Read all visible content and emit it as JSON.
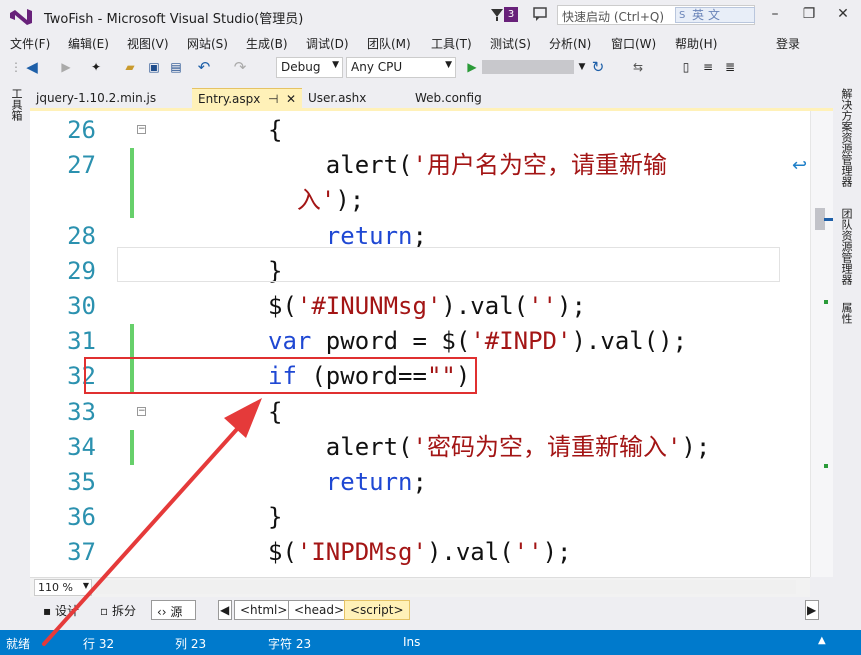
{
  "window": {
    "title": "TwoFish - Microsoft Visual Studio(管理员)",
    "notification_count": "3",
    "quick_launch_placeholder": "快速启动 (Ctrl+Q)",
    "ime_indicator": "英文",
    "ime_mark": "S",
    "controls": {
      "minimize": "–",
      "restore": "❐",
      "close": "✕"
    }
  },
  "menu": {
    "items": [
      "文件(F)",
      "编辑(E)",
      "视图(V)",
      "网站(S)",
      "生成(B)",
      "调试(D)",
      "团队(M)",
      "工具(T)",
      "测试(S)",
      "分析(N)",
      "窗口(W)",
      "帮助(H)"
    ],
    "login": "登录"
  },
  "toolbar": {
    "configuration": "Debug",
    "platform": "Any CPU",
    "start_icon": "▶"
  },
  "side_tabs": {
    "left": "工具箱",
    "right": [
      "解决方案资源管理器",
      "团队资源管理器",
      "属性"
    ]
  },
  "tabs": [
    {
      "label": "jquery-1.10.2.min.js",
      "active": false
    },
    {
      "label": "Entry.aspx",
      "active": true,
      "pin": "⊣",
      "close": "✕"
    },
    {
      "label": "User.ashx",
      "active": false
    },
    {
      "label": "Web.config",
      "active": false
    }
  ],
  "code_lines": [
    {
      "n": "26",
      "fold": "−",
      "bar": false,
      "parts": [
        {
          "t": "{",
          "c": "plain"
        }
      ]
    },
    {
      "n": "27",
      "fold": "",
      "bar": true,
      "parts": [
        {
          "t": "    alert(",
          "c": "plain"
        },
        {
          "t": "'用户名为空，请重新输",
          "c": "str"
        }
      ]
    },
    {
      "n": "",
      "fold": "",
      "bar": true,
      "parts": [
        {
          "t": "  入'",
          "c": "str"
        },
        {
          "t": ");",
          "c": "plain"
        }
      ]
    },
    {
      "n": "28",
      "fold": "",
      "bar": false,
      "parts": [
        {
          "t": "    ",
          "c": "plain"
        },
        {
          "t": "return",
          "c": "kw"
        },
        {
          "t": ";",
          "c": "plain"
        }
      ]
    },
    {
      "n": "29",
      "fold": "",
      "bar": false,
      "parts": [
        {
          "t": "}",
          "c": "plain"
        }
      ]
    },
    {
      "n": "30",
      "fold": "",
      "bar": false,
      "parts": [
        {
          "t": "$(",
          "c": "plain"
        },
        {
          "t": "'#INUNMsg'",
          "c": "str"
        },
        {
          "t": ").val(",
          "c": "plain"
        },
        {
          "t": "''",
          "c": "str"
        },
        {
          "t": ");",
          "c": "plain"
        }
      ]
    },
    {
      "n": "31",
      "fold": "",
      "bar": true,
      "parts": [
        {
          "t": "var",
          "c": "kw"
        },
        {
          "t": " pword = $(",
          "c": "plain"
        },
        {
          "t": "'#INPD'",
          "c": "str"
        },
        {
          "t": ").val();",
          "c": "plain"
        }
      ]
    },
    {
      "n": "32",
      "fold": "",
      "bar": true,
      "parts": [
        {
          "t": "if",
          "c": "kw"
        },
        {
          "t": " (pword==",
          "c": "plain"
        },
        {
          "t": "\"\"",
          "c": "str"
        },
        {
          "t": ")",
          "c": "plain"
        }
      ]
    },
    {
      "n": "33",
      "fold": "−",
      "bar": false,
      "parts": [
        {
          "t": "{",
          "c": "plain"
        }
      ]
    },
    {
      "n": "34",
      "fold": "",
      "bar": true,
      "parts": [
        {
          "t": "    alert(",
          "c": "plain"
        },
        {
          "t": "'密码为空，请重新输入'",
          "c": "str"
        },
        {
          "t": ");",
          "c": "plain"
        }
      ]
    },
    {
      "n": "35",
      "fold": "",
      "bar": false,
      "parts": [
        {
          "t": "    ",
          "c": "plain"
        },
        {
          "t": "return",
          "c": "kw"
        },
        {
          "t": ";",
          "c": "plain"
        }
      ]
    },
    {
      "n": "36",
      "fold": "",
      "bar": false,
      "parts": [
        {
          "t": "}",
          "c": "plain"
        }
      ]
    },
    {
      "n": "37",
      "fold": "",
      "bar": false,
      "parts": [
        {
          "t": "$(",
          "c": "plain"
        },
        {
          "t": "'INPDMsg'",
          "c": "str"
        },
        {
          "t": ").val(",
          "c": "plain"
        },
        {
          "t": "''",
          "c": "str"
        },
        {
          "t": ");",
          "c": "plain"
        }
      ]
    }
  ],
  "editor": {
    "zoom": "110 %"
  },
  "bottom_bar": {
    "design": "设计",
    "split": "拆分",
    "source": "源",
    "breadcrumbs": [
      "<html>",
      "<head>",
      "<script>"
    ]
  },
  "status": {
    "ready": "就绪",
    "line": "行 32",
    "col": "列 23",
    "char": "字符 23",
    "mode": "Ins"
  }
}
